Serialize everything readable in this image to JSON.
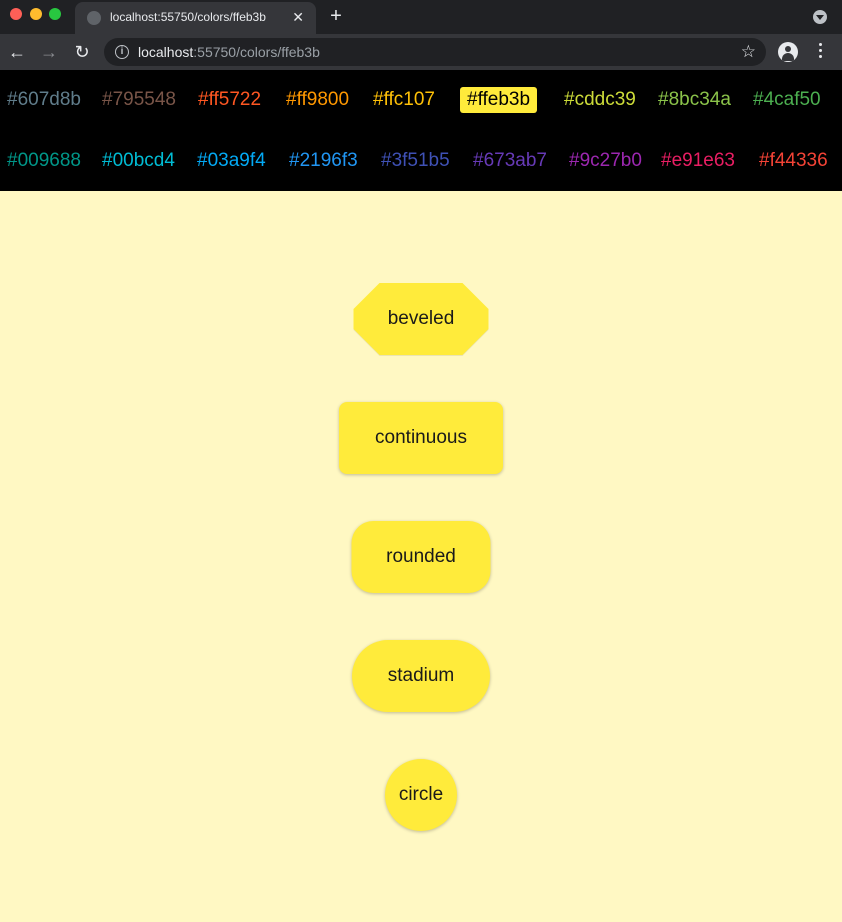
{
  "browser": {
    "tab_title": "localhost:55750/colors/ffeb3b",
    "tab_close": "✕",
    "new_tab": "+",
    "url_host": "localhost",
    "url_path": ":55750/colors/ffeb3b"
  },
  "palette": {
    "selected": "#ffeb3b",
    "row1": [
      {
        "label": "#607d8b",
        "color": "#607d8b"
      },
      {
        "label": "#795548",
        "color": "#795548"
      },
      {
        "label": "#ff5722",
        "color": "#ff5722"
      },
      {
        "label": "#ff9800",
        "color": "#ff9800"
      },
      {
        "label": "#ffc107",
        "color": "#ffc107"
      },
      {
        "label": "#ffeb3b",
        "color": "#ffeb3b"
      },
      {
        "label": "#cddc39",
        "color": "#cddc39"
      },
      {
        "label": "#8bc34a",
        "color": "#8bc34a"
      },
      {
        "label": "#4caf50",
        "color": "#4caf50"
      }
    ],
    "row2": [
      {
        "label": "#009688",
        "color": "#009688"
      },
      {
        "label": "#00bcd4",
        "color": "#00bcd4"
      },
      {
        "label": "#03a9f4",
        "color": "#03a9f4"
      },
      {
        "label": "#2196f3",
        "color": "#2196f3"
      },
      {
        "label": "#3f51b5",
        "color": "#3f51b5"
      },
      {
        "label": "#673ab7",
        "color": "#673ab7"
      },
      {
        "label": "#9c27b0",
        "color": "#9c27b0"
      },
      {
        "label": "#e91e63",
        "color": "#e91e63"
      },
      {
        "label": "#f44336",
        "color": "#f44336"
      }
    ]
  },
  "buttons": {
    "beveled": "beveled",
    "continuous": "continuous",
    "rounded": "rounded",
    "stadium": "stadium",
    "circle": "circle"
  },
  "colors": {
    "button_fill": "#ffeb3b",
    "page_background": "#fff8c3"
  }
}
